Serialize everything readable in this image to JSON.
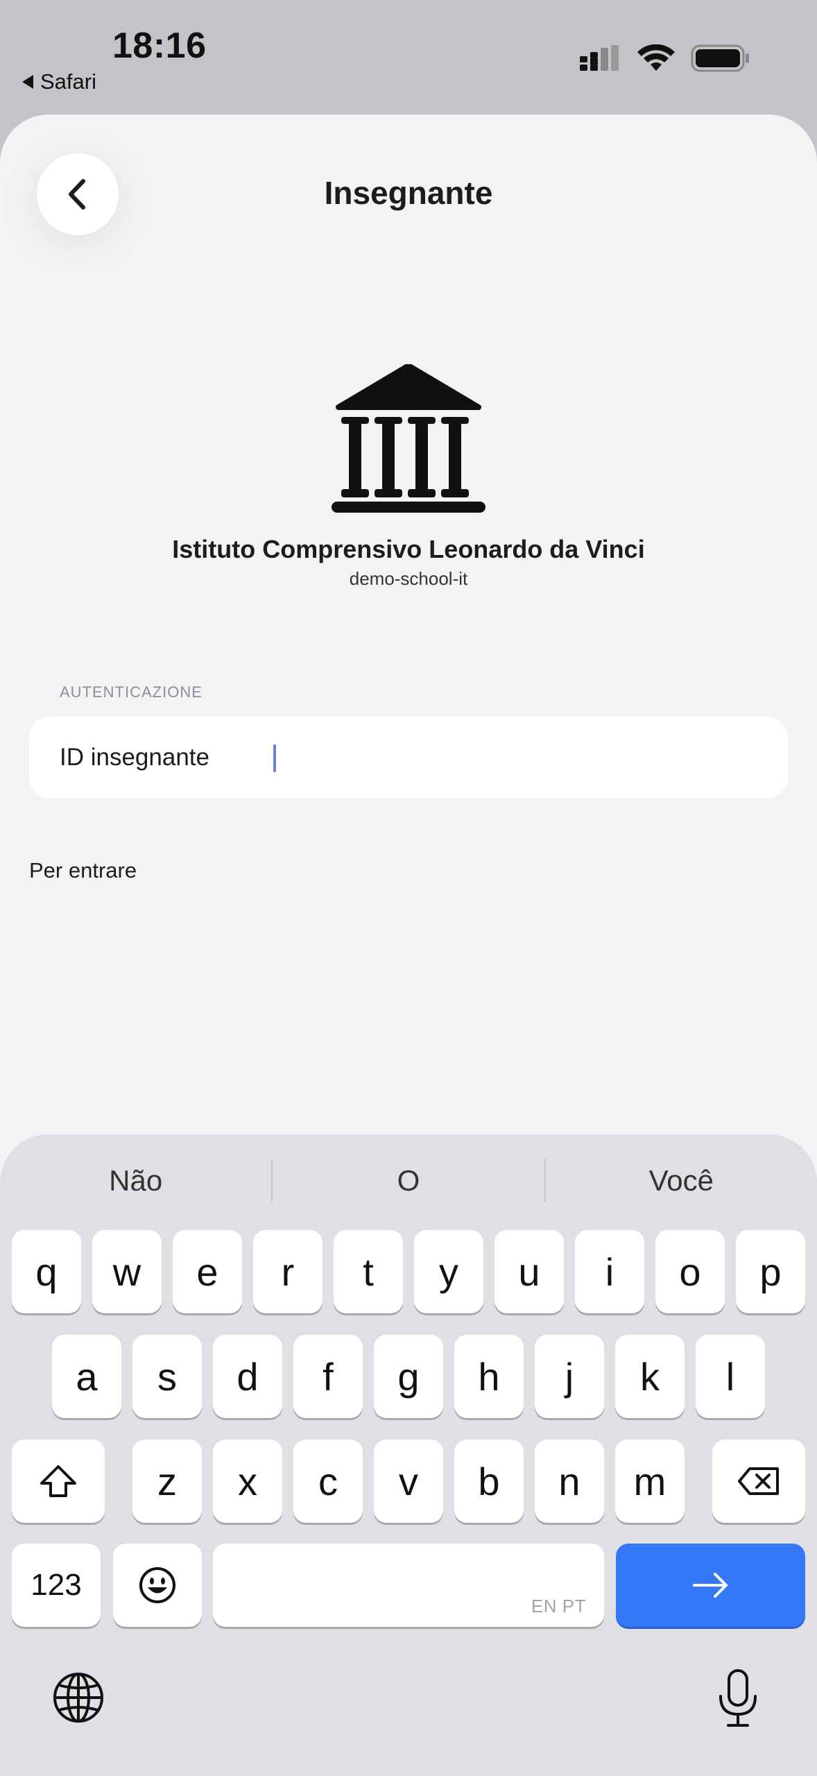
{
  "status_bar": {
    "time": "18:16",
    "back_app": "Safari"
  },
  "nav": {
    "title": "Insegnante"
  },
  "school": {
    "name": "Istituto Comprensivo Leonardo da Vinci",
    "id": "demo-school-it",
    "icon": "bank-building-icon"
  },
  "auth": {
    "section_label": "AUTENTICAZIONE",
    "field_label": "ID insegnante",
    "field_value": "",
    "hint": "Per entrare"
  },
  "keyboard": {
    "suggestions": [
      "Não",
      "O",
      "Você"
    ],
    "row1": [
      "q",
      "w",
      "e",
      "r",
      "t",
      "y",
      "u",
      "i",
      "o",
      "p"
    ],
    "row2": [
      "a",
      "s",
      "d",
      "f",
      "g",
      "h",
      "j",
      "k",
      "l"
    ],
    "row3": [
      "z",
      "x",
      "c",
      "v",
      "b",
      "n",
      "m"
    ],
    "numbers_label": "123",
    "space_languages": "EN PT",
    "accent_color": "#3478f6"
  }
}
